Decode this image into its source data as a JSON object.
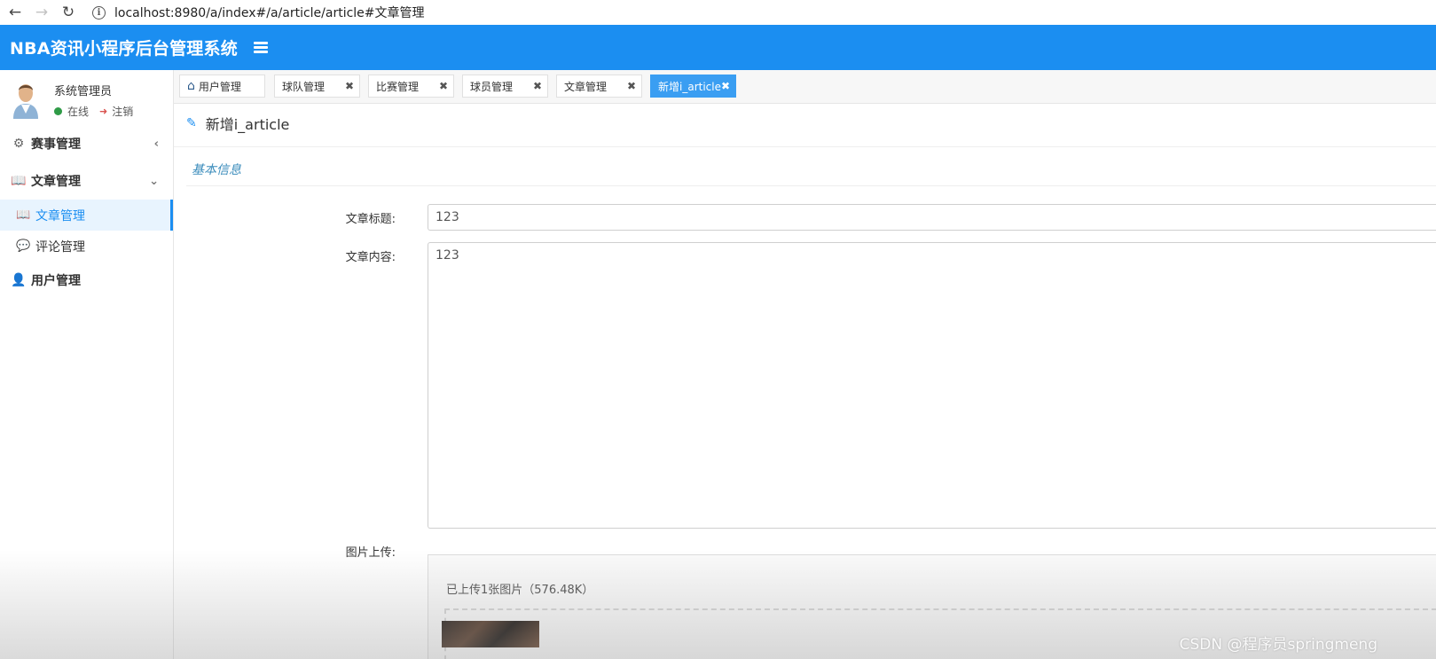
{
  "browser": {
    "url": "localhost:8980/a/index#/a/article/article#文章管理",
    "back_icon": "arrow-left-icon",
    "forward_icon": "arrow-right-icon",
    "reload_icon": "reload-icon"
  },
  "header": {
    "title": "NBA资讯小程序后台管理系统",
    "bg_color": "#1b8ef1"
  },
  "user": {
    "name": "系统管理员",
    "status": "在线",
    "logout": "注销",
    "status_color": "#2f9b47"
  },
  "sidebar": {
    "items": [
      {
        "label": "赛事管理",
        "icon": "gear-icon",
        "expanded": false
      },
      {
        "label": "文章管理",
        "icon": "book-icon",
        "expanded": true,
        "children": [
          {
            "label": "文章管理",
            "icon": "book-icon",
            "active": true
          },
          {
            "label": "评论管理",
            "icon": "comment-icon",
            "active": false
          }
        ]
      },
      {
        "label": "用户管理",
        "icon": "user-icon",
        "expanded": false
      }
    ]
  },
  "tabs": [
    {
      "label": "用户管理",
      "icon": "home-icon",
      "closable": false,
      "active": false
    },
    {
      "label": "球队管理",
      "closable": true,
      "active": false
    },
    {
      "label": "比赛管理",
      "closable": true,
      "active": false
    },
    {
      "label": "球员管理",
      "closable": true,
      "active": false
    },
    {
      "label": "文章管理",
      "closable": true,
      "active": false
    },
    {
      "label": "新增i_article",
      "closable": true,
      "active": true
    }
  ],
  "page": {
    "title": "新增i_article",
    "section": "基本信息",
    "fields": {
      "title_label": "文章标题:",
      "title_value": "123",
      "content_label": "文章内容:",
      "content_value": "123",
      "upload_label": "图片上传:",
      "upload_info": "已上传1张图片（576.48K）"
    }
  },
  "watermark": "CSDN @程序员springmeng"
}
